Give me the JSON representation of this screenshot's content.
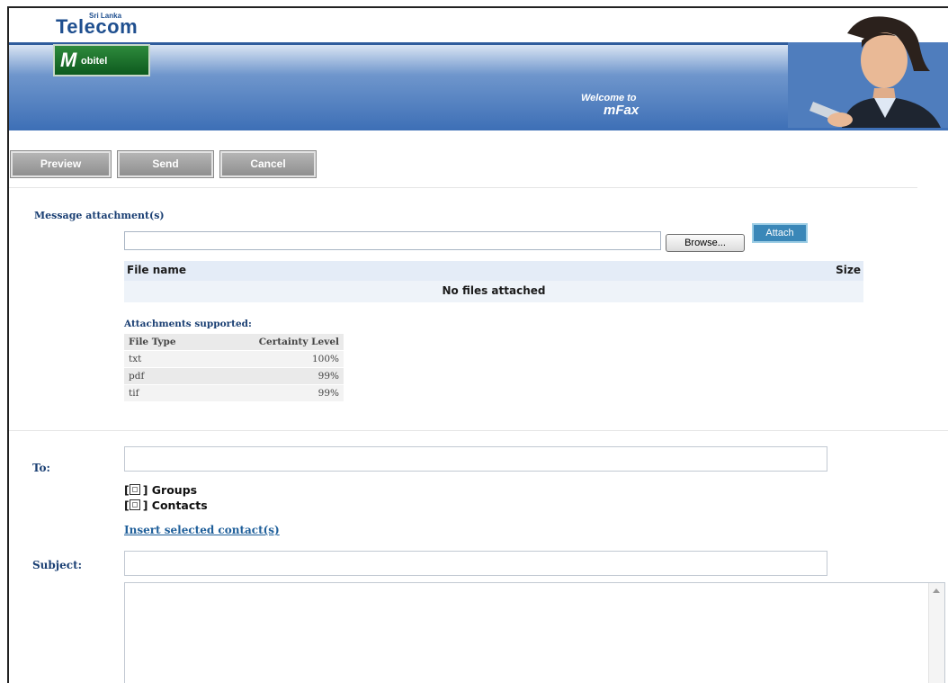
{
  "header": {
    "logo_brand_small": "Sri Lanka",
    "logo_brand": "Telecom",
    "logo_sub_initial": "M",
    "logo_sub_rest": "obitel",
    "welcome_line1": "Welcome to",
    "welcome_line2": "mFax"
  },
  "toolbar": {
    "preview_label": "Preview",
    "send_label": "Send",
    "cancel_label": "Cancel"
  },
  "attachments": {
    "section_title": "Message attachment(s)",
    "file_input_value": "",
    "browse_label": "Browse...",
    "attach_label": "Attach",
    "columns": {
      "file_name": "File name",
      "size": "Size"
    },
    "empty_message": "No files attached",
    "supported_title": "Attachments supported:",
    "supported_columns": {
      "file_type": "File Type",
      "certainty": "Certainty Level"
    },
    "supported": [
      {
        "type": "txt",
        "certainty": "100%"
      },
      {
        "type": "pdf",
        "certainty": "99%"
      },
      {
        "type": "tif",
        "certainty": "99%"
      }
    ]
  },
  "compose": {
    "to_label": "To:",
    "to_value": "",
    "groups_label": "Groups",
    "contacts_label": "Contacts",
    "insert_link": "Insert selected contact(s)",
    "subject_label": "Subject:",
    "subject_value": "",
    "body_value": ""
  },
  "colors": {
    "banner_blue": "#3d6fb6",
    "label_blue": "#1a3f73",
    "attach_blue": "#3a87b8",
    "button_gray": "#9e9e9e",
    "mobitel_green": "#1d7a2e"
  }
}
